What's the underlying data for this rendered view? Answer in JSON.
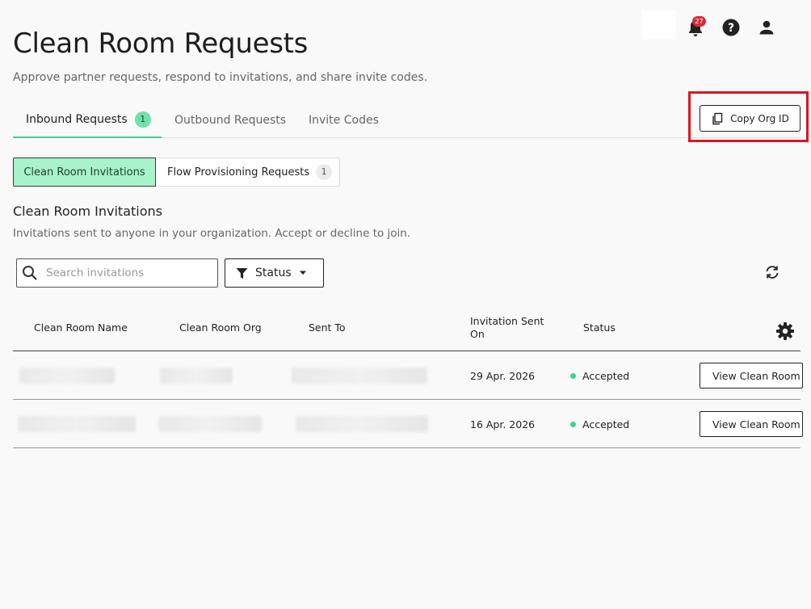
{
  "header": {
    "title": "Clean Room Requests",
    "subtitle": "Approve partner requests, respond to invitations, and share invite codes.",
    "notification_count": "27"
  },
  "tabs": [
    {
      "label": "Inbound Requests",
      "count": "1"
    },
    {
      "label": "Outbound Requests"
    },
    {
      "label": "Invite Codes"
    }
  ],
  "actions": {
    "copy_org_id": "Copy Org ID"
  },
  "segments": [
    {
      "label": "Clean Room Invitations"
    },
    {
      "label": "Flow Provisioning Requests",
      "count": "1"
    }
  ],
  "section": {
    "title": "Clean Room Invitations",
    "description": "Invitations sent to anyone in your organization. Accept or decline to join."
  },
  "search": {
    "placeholder": "Search invitations"
  },
  "filter": {
    "label": "Status"
  },
  "table": {
    "columns": [
      "Clean Room Name",
      "Clean Room Org",
      "Sent To",
      "Invitation Sent On",
      "Status"
    ],
    "rows": [
      {
        "date": "29 Apr. 2026",
        "status": "Accepted",
        "action": "View Clean Room"
      },
      {
        "date": "16 Apr. 2026",
        "status": "Accepted",
        "action": "View Clean Room"
      }
    ]
  },
  "colors": {
    "accent": "#3cd48d",
    "accent_light": "#a8f3cc",
    "badge": "#d62c3b",
    "highlight": "#e0141e"
  },
  "icons": {
    "notifications": "bell-icon",
    "help": "help-icon",
    "user": "user-icon",
    "copy": "copy-icon",
    "search": "search-icon",
    "filter": "filter-icon",
    "dropdown": "caret-down-icon",
    "refresh": "refresh-icon",
    "settings": "gear-icon"
  }
}
